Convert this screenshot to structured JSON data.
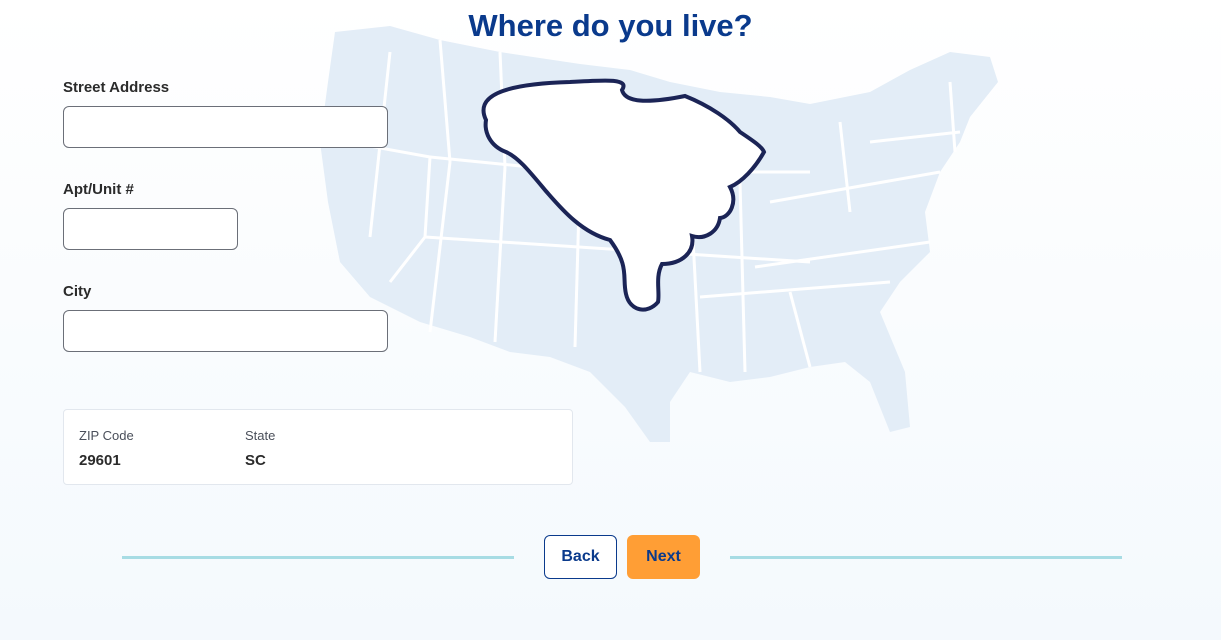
{
  "header": {
    "title": "Where do you live?"
  },
  "form": {
    "street": {
      "label": "Street Address",
      "value": "",
      "placeholder": ""
    },
    "apt": {
      "label": "Apt/Unit #",
      "value": "",
      "placeholder": ""
    },
    "city": {
      "label": "City",
      "value": "",
      "placeholder": ""
    }
  },
  "location_summary": {
    "zip_label": "ZIP Code",
    "zip_value": "29601",
    "state_label": "State",
    "state_value": "SC"
  },
  "navigation": {
    "back_label": "Back",
    "next_label": "Next"
  },
  "map": {
    "highlighted_state": "SC"
  },
  "colors": {
    "title": "#0a3a8c",
    "next_button": "#ff9e35",
    "map_states": "#e3edf7",
    "state_outline": "#1b2456",
    "divider": "#a7dce4"
  }
}
